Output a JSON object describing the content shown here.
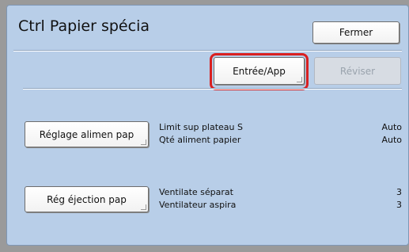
{
  "window": {
    "title": "Ctrl Papier spécia"
  },
  "buttons": {
    "close": "Fermer",
    "enter_apply": "Entrée/App",
    "revise": "Réviser",
    "feed_adjust": "Réglage alimen pap",
    "ejection_adjust": "Rég éjection pap"
  },
  "settings": {
    "feed": [
      {
        "label": "Limit sup plateau S",
        "value": "Auto"
      },
      {
        "label": "Qté aliment papier",
        "value": "Auto"
      }
    ],
    "ejection": [
      {
        "label": "Ventilate séparat",
        "value": "3"
      },
      {
        "label": "Ventilateur aspira",
        "value": "3"
      }
    ]
  },
  "colors": {
    "panel_bg": "#b8cee8",
    "highlight": "#d92020",
    "outer_bg": "#9a9a9a"
  }
}
